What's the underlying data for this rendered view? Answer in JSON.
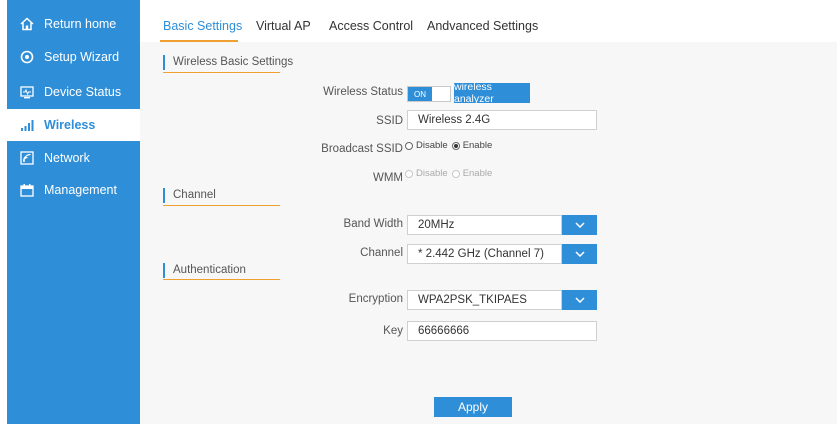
{
  "sidebar": {
    "items": [
      {
        "label": "Return home",
        "icon": "home-icon"
      },
      {
        "label": "Setup Wizard",
        "icon": "wizard-icon"
      },
      {
        "label": "Device Status",
        "icon": "monitor-icon"
      },
      {
        "label": "Wireless",
        "icon": "signal-bars-icon"
      },
      {
        "label": "Network",
        "icon": "network-icon"
      },
      {
        "label": "Management",
        "icon": "management-icon"
      }
    ],
    "active": "Wireless",
    "color": "#2f8ed8"
  },
  "tabs": [
    {
      "label": "Basic Settings"
    },
    {
      "label": "Virtual AP"
    },
    {
      "label": "Access Control"
    },
    {
      "label": "Andvanced Settings"
    }
  ],
  "active_tab": "Basic Settings",
  "sections": {
    "wireless_basic": "Wireless Basic Settings",
    "channel": "Channel",
    "authentication": "Authentication"
  },
  "form": {
    "wireless_status": {
      "label": "Wireless Status",
      "toggle_text": "ON",
      "analyzer_button": "wireless analyzer"
    },
    "ssid": {
      "label": "SSID",
      "value": "Wireless 2.4G"
    },
    "broadcast_ssid": {
      "label": "Broadcast SSID",
      "option_disable": "Disable",
      "option_enable": "Enable",
      "selected": "Enable"
    },
    "wmm": {
      "label": "WMM",
      "option_disable": "Disable",
      "option_enable": "Enable"
    },
    "band_width": {
      "label": "Band Width",
      "value": "20MHz"
    },
    "channel": {
      "label": "Channel",
      "value": "* 2.442 GHz (Channel 7)"
    },
    "encryption": {
      "label": "Encryption",
      "value": "WPA2PSK_TKIPAES"
    },
    "key": {
      "label": "Key",
      "value": "66666666"
    }
  },
  "apply_button": "Apply",
  "accent_color": "#f0a030"
}
